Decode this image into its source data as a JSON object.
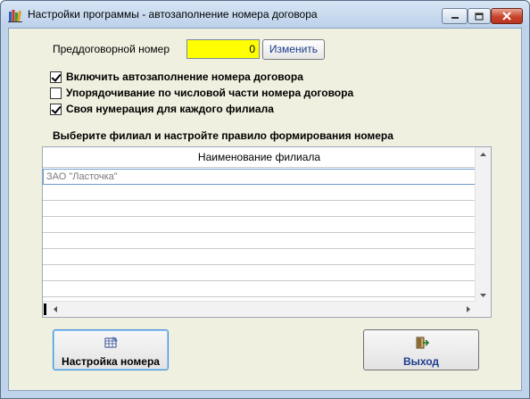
{
  "window": {
    "title": "Настройки программы - автозаполнение номера договора",
    "icon": "books-icon",
    "controls": [
      "minimize",
      "maximize",
      "close"
    ]
  },
  "pre_contract": {
    "label": "Преддоговорной номер",
    "value": "0",
    "change_button": "Изменить"
  },
  "options": [
    {
      "label": "Включить автозаполнение номера договора",
      "checked": true
    },
    {
      "label": "Упорядочивание по числовой части номера договора",
      "checked": false
    },
    {
      "label": "Своя нумерация для каждого филиала",
      "checked": true
    }
  ],
  "branch_section": {
    "label": "Выберите филиал и настройте правило формирования номера",
    "column_header": "Наименование филиала",
    "rows": [
      "ЗАО \"Ласточка\""
    ]
  },
  "buttons": {
    "setup": "Настройка номера",
    "exit": "Выход"
  },
  "colors": {
    "input_highlight": "#ffff00",
    "window_background": "#f0f0e1",
    "change_button_text": "#1c3c8c",
    "exit_text": "#1c3c8c"
  }
}
